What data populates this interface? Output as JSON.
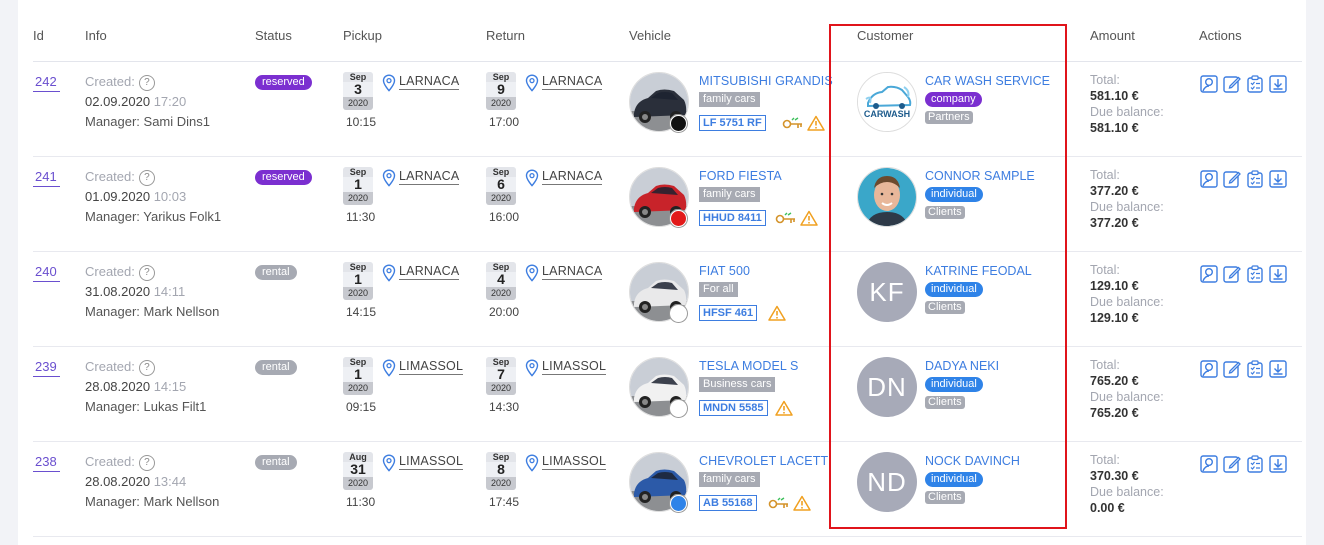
{
  "headers": {
    "id": "Id",
    "info": "Info",
    "status": "Status",
    "pickup": "Pickup",
    "return": "Return",
    "vehicle": "Vehicle",
    "customer": "Customer",
    "amount": "Amount",
    "actions": "Actions"
  },
  "labels": {
    "created": "Created:",
    "manager_prefix": "Manager:",
    "total": "Total:",
    "due_balance": "Due balance:",
    "qmark": "?"
  },
  "colors": {
    "accent": "#3d7de0",
    "purple": "#7b2fd0",
    "highlight": "#e0141b",
    "warning": "#f0a020",
    "key": "#d4932a"
  },
  "rows": [
    {
      "id": "242",
      "created_date": "02.09.2020",
      "created_time": "17:20",
      "manager": "Manager: Sami Dins1",
      "status": "reserved",
      "status_type": "reserved",
      "pickup": {
        "month": "Sep",
        "day": "3",
        "year": "2020",
        "time": "10:15",
        "location": "LARNACA"
      },
      "return": {
        "month": "Sep",
        "day": "9",
        "year": "2020",
        "time": "17:00",
        "location": "LARNACA"
      },
      "vehicle": {
        "name": "MITSUBISHI GRANDIS",
        "category": "family cars",
        "plate": "LF 5751 RF",
        "dot_color": "#111111",
        "has_key": true,
        "car_color": "#2a2f3a"
      },
      "customer": {
        "name": "CAR WASH SERVICE",
        "type": "company",
        "group": "Partners",
        "avatar": "carwash-logo",
        "initials": ""
      },
      "total": "581.10 €",
      "due": "581.10 €"
    },
    {
      "id": "241",
      "created_date": "01.09.2020",
      "created_time": "10:03",
      "manager": "Manager: Yarikus Folk1",
      "status": "reserved",
      "status_type": "reserved",
      "pickup": {
        "month": "Sep",
        "day": "1",
        "year": "2020",
        "time": "11:30",
        "location": "LARNACA"
      },
      "return": {
        "month": "Sep",
        "day": "6",
        "year": "2020",
        "time": "16:00",
        "location": "LARNACA"
      },
      "vehicle": {
        "name": "FORD FIESTA",
        "category": "family cars",
        "plate": "HHUD 8411",
        "dot_color": "#e21a1a",
        "has_key": true,
        "car_color": "#c8232a"
      },
      "customer": {
        "name": "CONNOR SAMPLE",
        "type": "individual",
        "group": "Clients",
        "avatar": "photo",
        "initials": ""
      },
      "total": "377.20 €",
      "due": "377.20 €"
    },
    {
      "id": "240",
      "created_date": "31.08.2020",
      "created_time": "14:11",
      "manager": "Manager: Mark Nellson",
      "status": "rental",
      "status_type": "rental",
      "pickup": {
        "month": "Sep",
        "day": "1",
        "year": "2020",
        "time": "14:15",
        "location": "LARNACA"
      },
      "return": {
        "month": "Sep",
        "day": "4",
        "year": "2020",
        "time": "20:00",
        "location": "LARNACA"
      },
      "vehicle": {
        "name": "FIAT 500",
        "category": "For all",
        "plate": "HFSF 461",
        "dot_color": "#ffffff",
        "has_key": false,
        "car_color": "#e9e9ea"
      },
      "customer": {
        "name": "KATRINE FEODAL",
        "type": "individual",
        "group": "Clients",
        "avatar": "initials",
        "initials": "KF"
      },
      "total": "129.10 €",
      "due": "129.10 €"
    },
    {
      "id": "239",
      "created_date": "28.08.2020",
      "created_time": "14:15",
      "manager": "Manager: Lukas Filt1",
      "status": "rental",
      "status_type": "rental",
      "pickup": {
        "month": "Sep",
        "day": "1",
        "year": "2020",
        "time": "09:15",
        "location": "LIMASSOL"
      },
      "return": {
        "month": "Sep",
        "day": "7",
        "year": "2020",
        "time": "14:30",
        "location": "LIMASSOL"
      },
      "vehicle": {
        "name": "TESLA MODEL S",
        "category": "Business cars",
        "plate": "MNDN 5585",
        "dot_color": "#ffffff",
        "has_key": false,
        "car_color": "#f1f1f1"
      },
      "customer": {
        "name": "DADYA NEKI",
        "type": "individual",
        "group": "Clients",
        "avatar": "initials",
        "initials": "DN"
      },
      "total": "765.20 €",
      "due": "765.20 €"
    },
    {
      "id": "238",
      "created_date": "28.08.2020",
      "created_time": "13:44",
      "manager": "Manager: Mark Nellson",
      "status": "rental",
      "status_type": "rental",
      "pickup": {
        "month": "Aug",
        "day": "31",
        "year": "2020",
        "time": "11:30",
        "location": "LIMASSOL"
      },
      "return": {
        "month": "Sep",
        "day": "8",
        "year": "2020",
        "time": "17:45",
        "location": "LIMASSOL"
      },
      "vehicle": {
        "name": "CHEVROLET LACETTI",
        "category": "family cars",
        "plate": "AB 55168",
        "dot_color": "#2f83e8",
        "has_key": true,
        "car_color": "#2c5aa8"
      },
      "customer": {
        "name": "NOCK DAVINCH",
        "type": "individual",
        "group": "Clients",
        "avatar": "initials",
        "initials": "ND"
      },
      "total": "370.30 €",
      "due": "0.00 €"
    }
  ],
  "action_icons": [
    "user-search-icon",
    "edit-icon",
    "checklist-icon",
    "download-icon"
  ]
}
